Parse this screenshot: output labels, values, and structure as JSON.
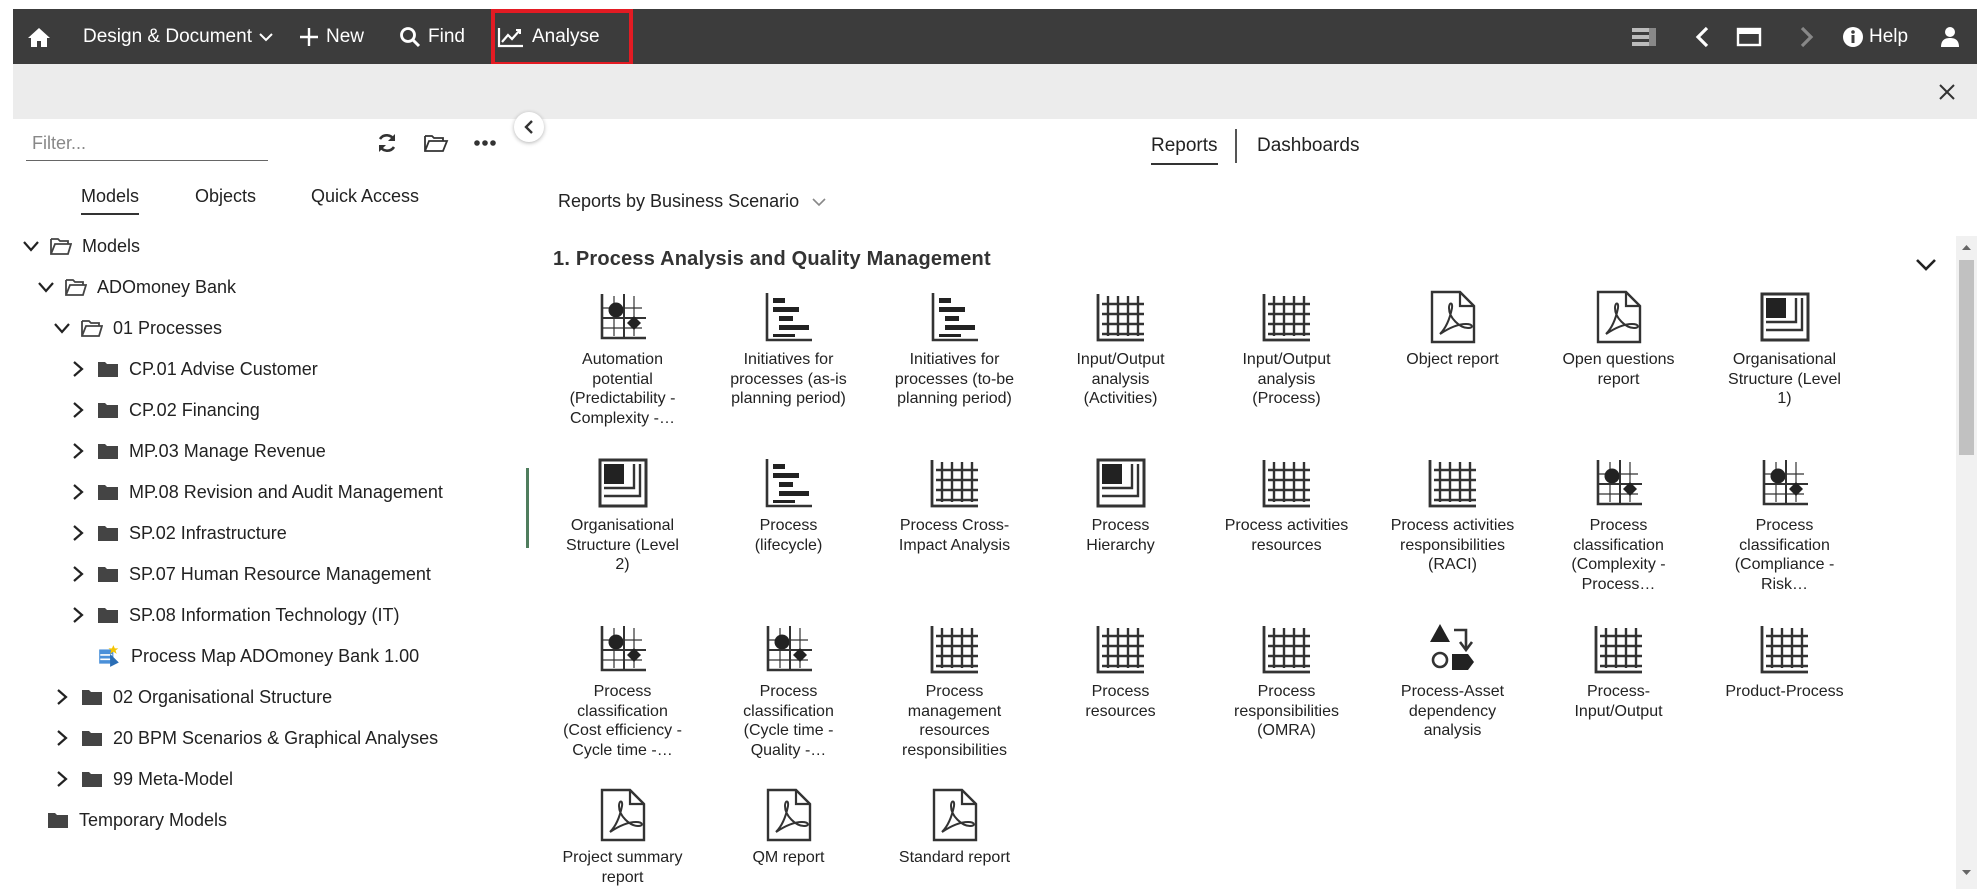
{
  "topbar": {
    "design_label": "Design & Document",
    "new_label": "New",
    "find_label": "Find",
    "analyse_label": "Analyse",
    "help_label": "Help"
  },
  "left": {
    "filter_placeholder": "Filter...",
    "tabs": [
      "Models",
      "Objects",
      "Quick Access"
    ],
    "tree": [
      {
        "label": "Models",
        "chevron": "down",
        "icon": "folder-open-icon"
      },
      {
        "label": "ADOmoney Bank",
        "chevron": "down",
        "icon": "folder-open-icon"
      },
      {
        "label": "01 Processes",
        "chevron": "down",
        "icon": "folder-open-icon"
      },
      {
        "label": "CP.01 Advise Customer",
        "chevron": "right",
        "icon": "folder-icon"
      },
      {
        "label": "CP.02 Financing",
        "chevron": "right",
        "icon": "folder-icon"
      },
      {
        "label": "MP.03 Manage Revenue",
        "chevron": "right",
        "icon": "folder-icon"
      },
      {
        "label": "MP.08 Revision and Audit Management",
        "chevron": "right",
        "icon": "folder-icon"
      },
      {
        "label": "SP.02 Infrastructure",
        "chevron": "right",
        "icon": "folder-icon"
      },
      {
        "label": "SP.07 Human Resource Management",
        "chevron": "right",
        "icon": "folder-icon"
      },
      {
        "label": "SP.08 Information Technology (IT)",
        "chevron": "right",
        "icon": "folder-icon"
      },
      {
        "label": "Process Map ADOmoney Bank 1.00",
        "chevron": "none",
        "icon": "process-map-icon"
      },
      {
        "label": "02 Organisational Structure",
        "chevron": "right",
        "icon": "folder-icon"
      },
      {
        "label": "20 BPM Scenarios & Graphical Analyses",
        "chevron": "right",
        "icon": "folder-icon"
      },
      {
        "label": "99 Meta-Model",
        "chevron": "right",
        "icon": "folder-icon"
      },
      {
        "label": "Temporary Models",
        "chevron": "none",
        "icon": "folder-icon"
      }
    ]
  },
  "right": {
    "tabs": [
      "Reports",
      "Dashboards"
    ],
    "scenario_label": "Reports by Business Scenario",
    "section_title": "1. Process Analysis and Quality Management",
    "reports": [
      {
        "label": "Automation potential (Predictability - Complexity -…",
        "icon": "portfolio-icon"
      },
      {
        "label": "Initiatives for processes (as-is planning period)",
        "icon": "gantt-icon"
      },
      {
        "label": "Initiatives for processes (to-be planning period)",
        "icon": "gantt-icon"
      },
      {
        "label": "Input/Output analysis (Activities)",
        "icon": "matrix-icon"
      },
      {
        "label": "Input/Output analysis (Process)",
        "icon": "matrix-icon"
      },
      {
        "label": "Object report",
        "icon": "pdf-icon"
      },
      {
        "label": "Open questions report",
        "icon": "pdf-icon"
      },
      {
        "label": "Organisational Structure (Level 1)",
        "icon": "hierarchy-icon"
      },
      {
        "label": "Organisational Structure (Level 2)",
        "icon": "hierarchy-icon"
      },
      {
        "label": "Process (lifecycle)",
        "icon": "gantt-icon"
      },
      {
        "label": "Process Cross-Impact Analysis",
        "icon": "matrix-icon"
      },
      {
        "label": "Process Hierarchy",
        "icon": "hierarchy-icon"
      },
      {
        "label": "Process activities resources",
        "icon": "matrix-icon"
      },
      {
        "label": "Process activities responsibilities (RACI)",
        "icon": "matrix-icon"
      },
      {
        "label": "Process classification (Complexity - Process…",
        "icon": "portfolio-icon"
      },
      {
        "label": "Process classification (Compliance - Risk…",
        "icon": "portfolio-icon"
      },
      {
        "label": "Process classification (Cost efficiency - Cycle time -…",
        "icon": "portfolio-icon"
      },
      {
        "label": "Process classification (Cycle time - Quality -…",
        "icon": "portfolio-icon"
      },
      {
        "label": "Process management resources responsibilities",
        "icon": "matrix-icon"
      },
      {
        "label": "Process resources",
        "icon": "matrix-icon"
      },
      {
        "label": "Process responsibilities (OMRA)",
        "icon": "matrix-icon"
      },
      {
        "label": "Process-Asset dependency analysis",
        "icon": "dependency-icon"
      },
      {
        "label": "Process-Input/Output",
        "icon": "matrix-icon"
      },
      {
        "label": "Product-Process",
        "icon": "matrix-icon"
      },
      {
        "label": "Project summary report",
        "icon": "pdf-icon"
      },
      {
        "label": "QM report",
        "icon": "pdf-icon"
      },
      {
        "label": "Standard report",
        "icon": "pdf-icon"
      }
    ]
  }
}
